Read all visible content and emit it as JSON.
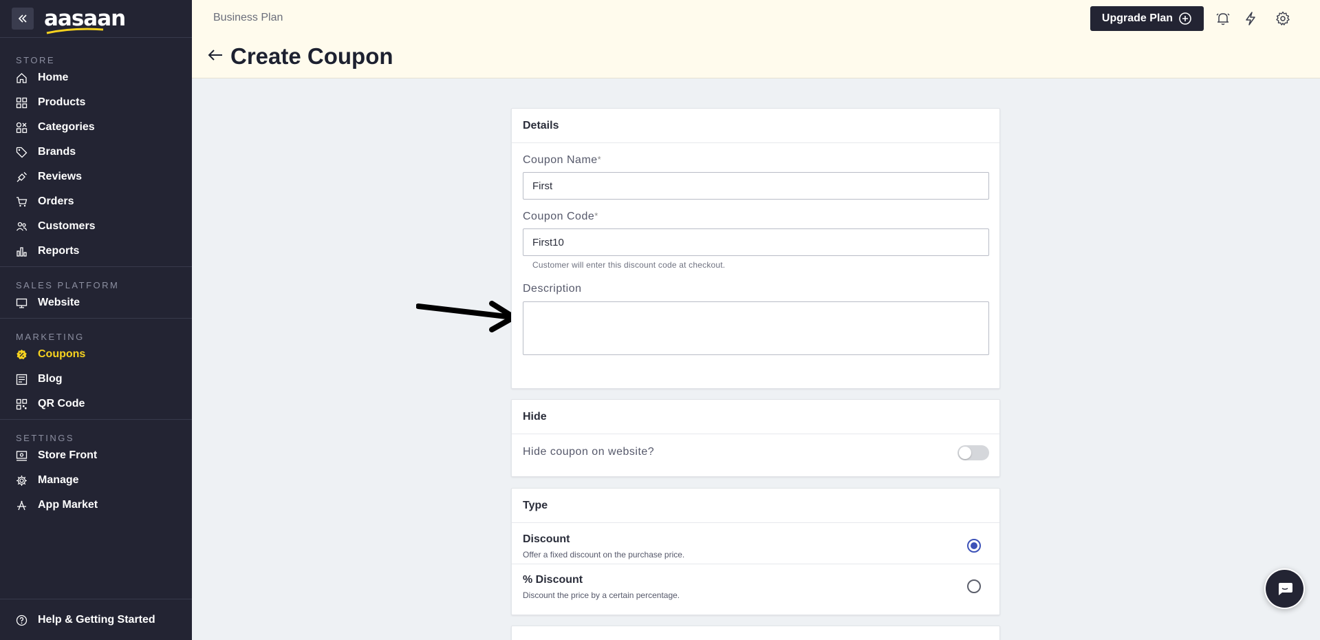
{
  "brand": {
    "logo_text": "aasaan"
  },
  "sidebar": {
    "sections": [
      {
        "heading": "STORE",
        "items": [
          {
            "label": "Home",
            "icon": "home-icon"
          },
          {
            "label": "Products",
            "icon": "grid-icon"
          },
          {
            "label": "Categories",
            "icon": "shapes-icon"
          },
          {
            "label": "Brands",
            "icon": "tag-icon"
          },
          {
            "label": "Reviews",
            "icon": "reviews-icon"
          },
          {
            "label": "Orders",
            "icon": "cart-icon"
          },
          {
            "label": "Customers",
            "icon": "users-icon"
          },
          {
            "label": "Reports",
            "icon": "bar-chart-icon"
          }
        ]
      },
      {
        "heading": "SALES PLATFORM",
        "items": [
          {
            "label": "Website",
            "icon": "monitor-icon"
          }
        ]
      },
      {
        "heading": "MARKETING",
        "items": [
          {
            "label": "Coupons",
            "icon": "coupon-badge-icon",
            "active": true
          },
          {
            "label": "Blog",
            "icon": "blog-icon"
          },
          {
            "label": "QR Code",
            "icon": "qr-code-icon"
          }
        ]
      },
      {
        "heading": "SETTINGS",
        "items": [
          {
            "label": "Store Front",
            "icon": "storefront-icon"
          },
          {
            "label": "Manage",
            "icon": "gear-icon"
          },
          {
            "label": "App Market",
            "icon": "app-market-icon"
          }
        ]
      }
    ],
    "footer": {
      "label": "Help & Getting Started",
      "icon": "help-icon"
    }
  },
  "header": {
    "breadcrumb": "Business Plan",
    "title": "Create Coupon",
    "upgrade_label": "Upgrade Plan"
  },
  "details": {
    "heading": "Details",
    "coupon_name": {
      "label": "Coupon Name",
      "required_mark": "*",
      "value": "First"
    },
    "coupon_code": {
      "label": "Coupon Code",
      "required_mark": "*",
      "value": "First10",
      "hint": "Customer will enter this discount code at checkout."
    },
    "description": {
      "label": "Description",
      "value": ""
    }
  },
  "hide": {
    "heading": "Hide",
    "label": "Hide coupon on website?",
    "enabled": false
  },
  "type": {
    "heading": "Type",
    "options": [
      {
        "title": "Discount",
        "desc": "Offer a fixed discount on the purchase price.",
        "selected": true
      },
      {
        "title": "% Discount",
        "desc": "Discount the price by a certain percentage.",
        "selected": false
      }
    ]
  },
  "colors": {
    "sidebar_bg": "#232433",
    "active_accent": "#f6d21f",
    "header_bg": "#fffbed",
    "radio_accent": "#3d52b8"
  }
}
